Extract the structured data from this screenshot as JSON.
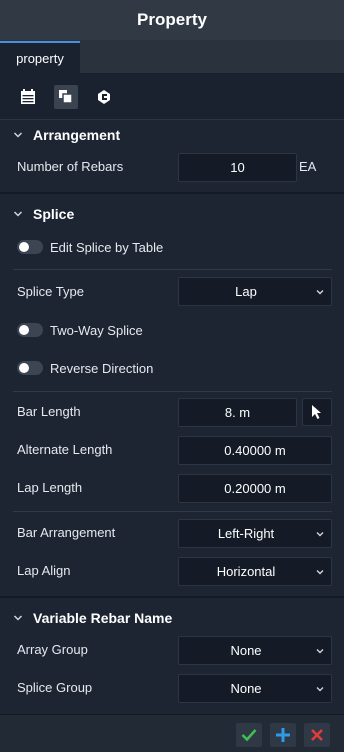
{
  "window": {
    "title": "Property"
  },
  "tabs": [
    {
      "label": "property"
    }
  ],
  "toolbar": {
    "icons": [
      "calendar-icon",
      "layers-icon",
      "refresh-icon"
    ]
  },
  "sections": {
    "arrangement": {
      "title": "Arrangement",
      "number_of_rebars": {
        "label": "Number of Rebars",
        "value": "10",
        "unit": "EA"
      }
    },
    "splice": {
      "title": "Splice",
      "edit_by_table": {
        "label": "Edit Splice by Table",
        "on": false
      },
      "splice_type": {
        "label": "Splice Type",
        "value": "Lap"
      },
      "two_way": {
        "label": "Two-Way Splice",
        "on": false
      },
      "reverse": {
        "label": "Reverse Direction",
        "on": false
      },
      "bar_length": {
        "label": "Bar Length",
        "value": "8. m"
      },
      "alternate_length": {
        "label": "Alternate Length",
        "value": "0.40000 m"
      },
      "lap_length": {
        "label": "Lap Length",
        "value": "0.20000 m"
      },
      "bar_arrangement": {
        "label": "Bar Arrangement",
        "value": "Left-Right"
      },
      "lap_align": {
        "label": "Lap Align",
        "value": "Horizontal"
      }
    },
    "variable_rebar_name": {
      "title": "Variable Rebar Name",
      "array_group": {
        "label": "Array Group",
        "value": "None"
      },
      "splice_group": {
        "label": "Splice Group",
        "value": "None"
      }
    }
  },
  "footer": {
    "buttons": [
      "confirm-icon",
      "add-icon",
      "close-icon"
    ],
    "colors": {
      "confirm": "#3fbf4f",
      "add": "#2f9be8",
      "close": "#e23b3b"
    }
  }
}
